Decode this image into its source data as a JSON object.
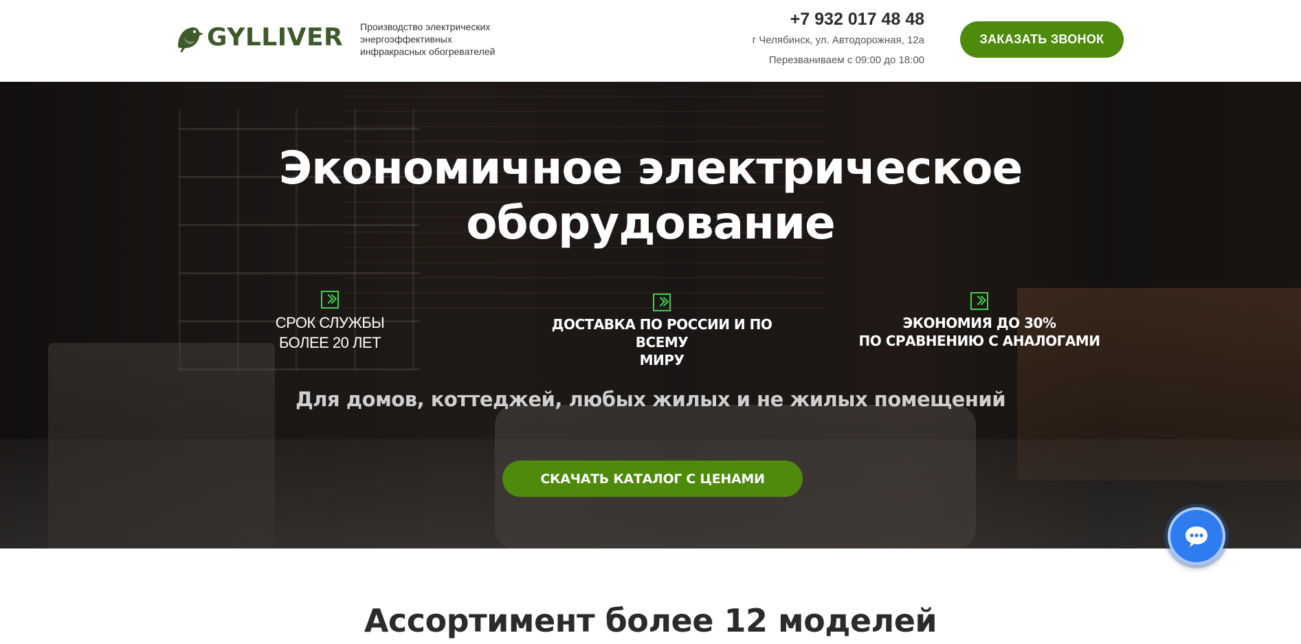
{
  "header": {
    "logo_text": "GYLLIVER",
    "tagline_line1": "Производство электрических",
    "tagline_line2": "энергоэффективных",
    "tagline_line3": "инфракрасных обогревателей",
    "phone": "+7 932 017 48 48",
    "address": "г Челябинск, ул. Автодорожная, 12а",
    "hours": "Перезваниваем с 09:00 до 18:00",
    "call_button_label": "ЗАКАЗАТЬ ЗВОНОК"
  },
  "hero": {
    "title_line1": "Экономичное электрическое",
    "title_line2": "оборудование",
    "features": [
      {
        "line1": "СРОК СЛУЖБЫ",
        "line2": "БОЛЕЕ 20 ЛЕТ",
        "icon": "double-chevron-icon"
      },
      {
        "line1": "ДОСТАВКА ПО РОССИИ И ПО ВСЕМУ",
        "line2": "МИРУ",
        "icon": "double-chevron-icon"
      },
      {
        "line1": "ЭКОНОМИЯ ДО 30%",
        "line2": "ПО СРАВНЕНИЮ С АНАЛОГАМИ",
        "icon": "double-chevron-icon"
      }
    ],
    "subtitle": "Для домов, коттеджей, любых жилых и не жилых помещений",
    "catalog_button_label": "СКАЧАТЬ КАТАЛОГ С ЦЕНАМИ"
  },
  "chat_widget": {
    "icon": "chat-bubble-icon"
  },
  "assortment": {
    "title": "Ассортимент более 12 моделей"
  },
  "colors": {
    "brand_green": "#4e8a0b",
    "logo_green": "#3f5a2a",
    "icon_green": "#3fd24a",
    "chat_blue": "#2f7cf0"
  }
}
